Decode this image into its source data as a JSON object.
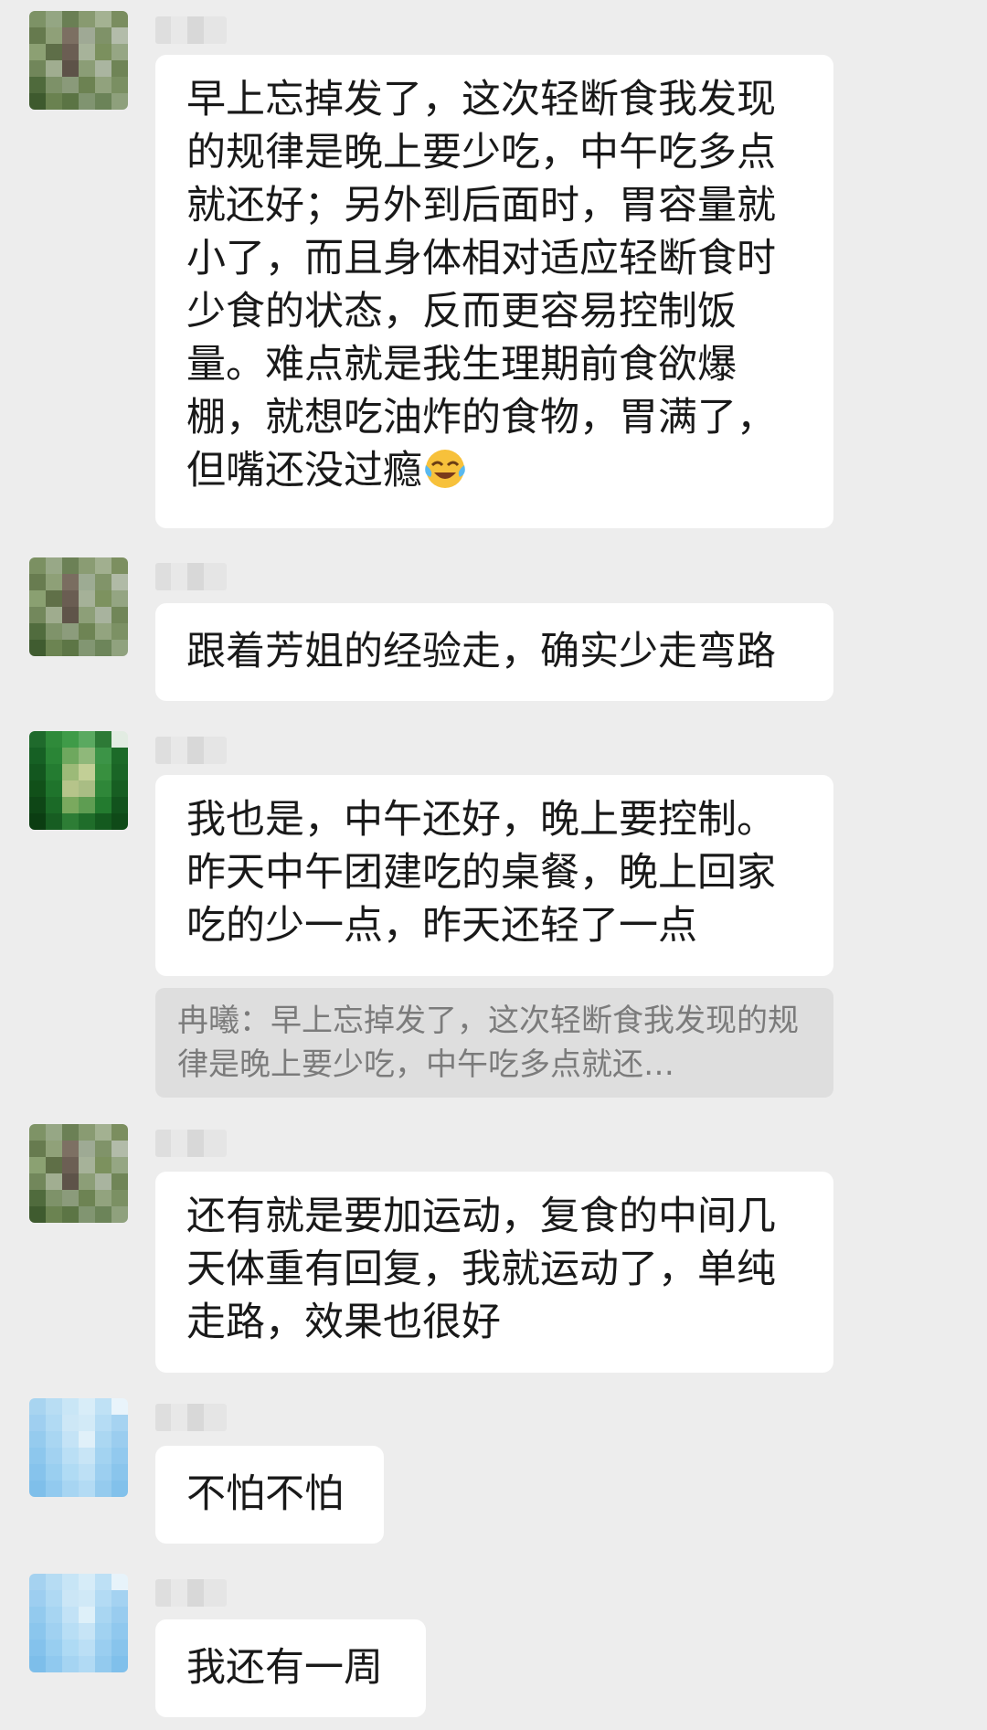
{
  "messages": [
    {
      "text": "早上忘掉发了，这次轻断食我发现的规律是晚上要少吃，中午吃多点就还好；另外到后面时，胃容量就小了，而且身体相对适应轻断食时少食的状态，反而更容易控制饭量。难点就是我生理期前食欲爆棚，就想吃油炸的食物，胃满了，但嘴还没过瘾",
      "emoji": "crying-laughing-emoji"
    },
    {
      "text": "跟着芳姐的经验走，确实少走弯路"
    },
    {
      "text": "我也是，中午还好，晚上要控制。昨天中午团建吃的桌餐，晚上回家吃的少一点，昨天还轻了一点",
      "quote": "冉曦：早上忘掉发了，这次轻断食我发现的规律是晚上要少吃，中午吃多点就还…"
    },
    {
      "text": "还有就是要加运动，复食的中间几天体重有回复，我就运动了，单纯走路，效果也很好"
    },
    {
      "text": "不怕不怕"
    },
    {
      "text": "我还有一周"
    }
  ],
  "colors": {
    "background": "#ededed",
    "bubble": "#ffffff",
    "quote_background": "#dedede",
    "text": "#191919",
    "quote_text": "#7b7b7b"
  }
}
